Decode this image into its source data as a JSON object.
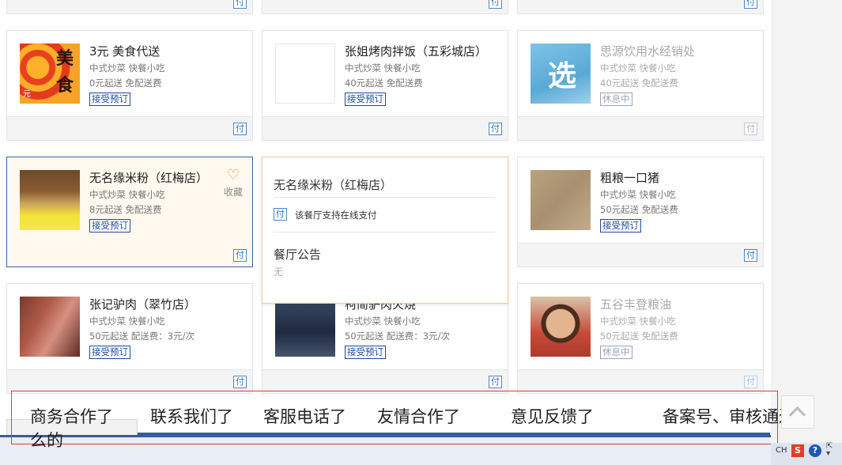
{
  "cards_row0": [
    {
      "pay": "付"
    },
    {
      "pay": "付"
    },
    {
      "pay": "付"
    }
  ],
  "cards": [
    {
      "name": "3元 美食代送",
      "meta1": "中式炒菜  快餐小吃",
      "meta2": "0元起送  免配送费",
      "status": "接受预订",
      "pay": "付",
      "thumb_text": "美食",
      "thumb_small": "元"
    },
    {
      "name": "张姐烤肉拌饭（五彩城店）",
      "meta1": "中式炒菜  快餐小吃",
      "meta2": "40元起送  免配送费",
      "status": "接受预订",
      "pay": "付"
    },
    {
      "name": "思源饮用水经销处",
      "meta1": "中式炒菜  快餐小吃",
      "meta2": "40元起送  免配送费",
      "status": "休息中",
      "pay": "付",
      "thumb_text": "选"
    },
    {
      "name": "无名缘米粉（红梅店）",
      "meta1": "中式炒菜  快餐小吃",
      "meta2": "8元起送  免配送费",
      "status": "接受预订",
      "pay": "付",
      "fav_label": "收藏"
    },
    {
      "name": "粗粮一口猪",
      "meta1": "中式炒菜  快餐小吃",
      "meta2": "50元起送  免配送费",
      "status": "接受预订",
      "pay": "付"
    },
    {
      "name": "张记驴肉（翠竹店）",
      "meta1": "中式炒菜  快餐小吃",
      "meta2": "50元起送  配送费：3元/次",
      "status": "接受预订",
      "pay": "付"
    },
    {
      "name": "柯简驴肉火烧",
      "meta1": "中式炒菜  快餐小吃",
      "meta2": "50元起送  配送费：3元/次",
      "status": "接受预订",
      "pay": "付"
    },
    {
      "name": "五谷丰登粮油",
      "meta1": "中式炒菜  快餐小吃",
      "meta2": "50元起送  免配送费",
      "status": "休息中",
      "pay": "付"
    }
  ],
  "popup": {
    "title": "无名缘米粉（红梅店）",
    "pay_icon": "付",
    "pay_text": "该餐厅支持在线支付",
    "notice_title": "餐厅公告",
    "notice_value": "无"
  },
  "annotations": {
    "biz": "商务合作了",
    "biz_tail": "么的",
    "contact": "联系我们了",
    "service": "客服电话了",
    "friends": "友情合作了",
    "feedback": "意见反馈了",
    "icp": "备案号、审核通过什"
  },
  "taskbar": {
    "lang": "CH",
    "sogou": "S",
    "help": "?"
  },
  "colors": {
    "accent_blue": "#1d4aa2",
    "hover_bg": "#fff8ee",
    "annotation_red": "#d9403a"
  }
}
